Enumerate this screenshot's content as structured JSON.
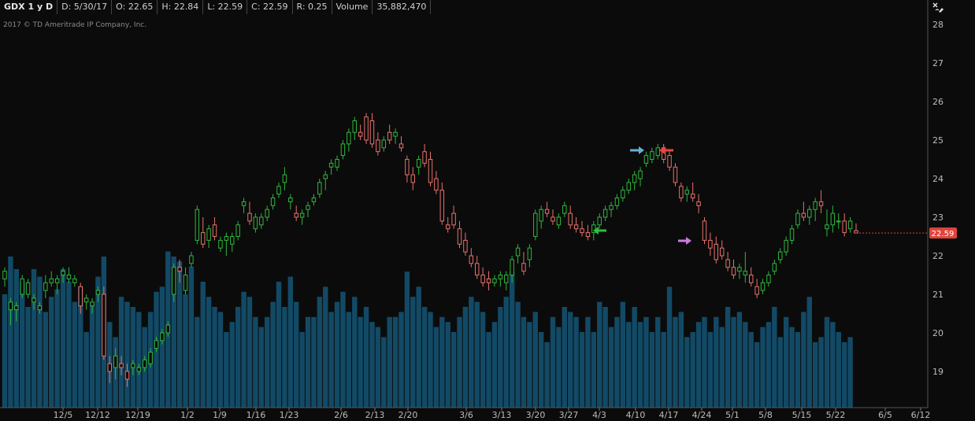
{
  "header": {
    "symbol": "GDX 1 y D",
    "date": "D: 5/30/17",
    "open": "O: 22.65",
    "high": "H: 22.84",
    "low": "L: 22.59",
    "close": "C: 22.59",
    "range": "R: 0.25",
    "volume_label": "Volume",
    "volume_value": "35,882,470"
  },
  "copyright": "2017 © TD Ameritrade IP Company, Inc.",
  "icons": {
    "settings": "settings-style-icon"
  },
  "colors": {
    "up": "#2db83d",
    "down": "#e8716a",
    "volume": "#124a66",
    "last_price_badge": "#e0443a",
    "arrow_blue": "#6aaed6",
    "arrow_red": "#e8483d",
    "arrow_green": "#2dbe3d",
    "arrow_purple": "#c97ce0"
  },
  "chart_data": {
    "type": "candlestick",
    "ylim": [
      18,
      28.3
    ],
    "yticks": [
      "28",
      "27",
      "26",
      "25",
      "24",
      "23",
      "22",
      "21",
      "20",
      "19"
    ],
    "xticks": [
      "12/5",
      "12/12",
      "12/19",
      "1/2",
      "1/9",
      "1/16",
      "1/23",
      "2/6",
      "2/13",
      "2/20",
      "3/6",
      "3/13",
      "3/20",
      "3/27",
      "4/3",
      "4/10",
      "4/17",
      "4/24",
      "5/1",
      "5/8",
      "5/15",
      "5/22",
      "6/5",
      "6/12"
    ],
    "last_price": "22.59",
    "ohlc": [
      [
        21.4,
        21.7,
        21.2,
        21.6
      ],
      [
        20.6,
        20.9,
        20.2,
        20.8
      ],
      [
        20.6,
        20.8,
        20.3,
        20.7
      ],
      [
        21.0,
        21.5,
        20.9,
        21.4
      ],
      [
        21.0,
        21.4,
        20.9,
        21.3
      ],
      [
        20.8,
        21.0,
        20.6,
        20.9
      ],
      [
        20.6,
        20.8,
        20.5,
        20.7
      ],
      [
        21.1,
        21.5,
        20.9,
        21.3
      ],
      [
        21.3,
        21.6,
        21.2,
        21.4
      ],
      [
        21.3,
        21.5,
        21.0,
        21.4
      ],
      [
        21.5,
        21.7,
        21.3,
        21.6
      ],
      [
        21.4,
        21.7,
        21.3,
        21.5
      ],
      [
        21.3,
        21.5,
        21.2,
        21.4
      ],
      [
        21.2,
        21.3,
        20.5,
        20.7
      ],
      [
        20.8,
        21.0,
        20.6,
        20.9
      ],
      [
        20.7,
        20.9,
        20.5,
        20.8
      ],
      [
        21.0,
        21.2,
        20.8,
        21.1
      ],
      [
        21.0,
        21.2,
        19.3,
        19.4
      ],
      [
        19.2,
        19.4,
        18.7,
        19.0
      ],
      [
        19.1,
        19.6,
        18.8,
        19.4
      ],
      [
        19.2,
        19.4,
        18.9,
        19.1
      ],
      [
        19.0,
        19.2,
        18.6,
        18.8
      ],
      [
        19.1,
        19.3,
        18.9,
        19.2
      ],
      [
        19.0,
        19.2,
        18.9,
        19.1
      ],
      [
        19.1,
        19.4,
        19.0,
        19.3
      ],
      [
        19.2,
        19.6,
        19.1,
        19.5
      ],
      [
        19.6,
        19.9,
        19.5,
        19.8
      ],
      [
        19.8,
        20.1,
        19.7,
        20.0
      ],
      [
        20.0,
        20.3,
        19.9,
        20.2
      ],
      [
        21.0,
        21.8,
        20.8,
        21.7
      ],
      [
        21.7,
        21.9,
        21.3,
        21.6
      ],
      [
        21.1,
        21.7,
        21.0,
        21.5
      ],
      [
        21.8,
        22.1,
        21.7,
        22.0
      ],
      [
        22.4,
        23.3,
        22.3,
        23.2
      ],
      [
        22.6,
        23.0,
        22.2,
        22.3
      ],
      [
        22.4,
        22.8,
        22.2,
        22.7
      ],
      [
        22.8,
        23.0,
        22.4,
        22.5
      ],
      [
        22.2,
        22.5,
        22.1,
        22.4
      ],
      [
        22.4,
        22.6,
        22.0,
        22.5
      ],
      [
        22.3,
        22.6,
        22.1,
        22.5
      ],
      [
        22.5,
        22.9,
        22.4,
        22.8
      ],
      [
        23.3,
        23.5,
        23.1,
        23.4
      ],
      [
        23.1,
        23.4,
        22.8,
        22.9
      ],
      [
        22.7,
        23.1,
        22.6,
        23.0
      ],
      [
        22.8,
        23.1,
        22.7,
        23.0
      ],
      [
        23.0,
        23.3,
        22.9,
        23.2
      ],
      [
        23.3,
        23.6,
        23.2,
        23.5
      ],
      [
        23.6,
        23.9,
        23.5,
        23.8
      ],
      [
        23.9,
        24.3,
        23.7,
        24.1
      ],
      [
        23.4,
        23.6,
        23.2,
        23.5
      ],
      [
        23.1,
        23.3,
        22.9,
        23.0
      ],
      [
        23.0,
        23.2,
        22.8,
        23.1
      ],
      [
        23.2,
        23.4,
        23.0,
        23.3
      ],
      [
        23.4,
        23.6,
        23.3,
        23.5
      ],
      [
        23.6,
        24.0,
        23.5,
        23.9
      ],
      [
        24.0,
        24.2,
        23.7,
        24.1
      ],
      [
        24.3,
        24.5,
        24.1,
        24.4
      ],
      [
        24.3,
        24.6,
        24.2,
        24.5
      ],
      [
        24.6,
        25.0,
        24.5,
        24.9
      ],
      [
        24.9,
        25.3,
        24.7,
        25.2
      ],
      [
        25.2,
        25.6,
        25.0,
        25.5
      ],
      [
        25.2,
        25.4,
        25.0,
        25.1
      ],
      [
        25.6,
        25.7,
        24.9,
        25.0
      ],
      [
        25.5,
        25.7,
        24.8,
        24.9
      ],
      [
        25.0,
        25.2,
        24.6,
        24.7
      ],
      [
        24.8,
        25.1,
        24.7,
        25.0
      ],
      [
        25.2,
        25.4,
        24.9,
        25.0
      ],
      [
        25.1,
        25.3,
        24.9,
        25.2
      ],
      [
        24.9,
        25.1,
        24.7,
        24.8
      ],
      [
        24.5,
        24.6,
        23.9,
        24.1
      ],
      [
        24.1,
        24.3,
        23.7,
        23.9
      ],
      [
        24.3,
        24.6,
        24.1,
        24.5
      ],
      [
        24.7,
        24.9,
        24.3,
        24.4
      ],
      [
        24.5,
        24.7,
        23.8,
        23.9
      ],
      [
        24.0,
        24.2,
        23.6,
        23.7
      ],
      [
        23.7,
        23.9,
        22.8,
        22.9
      ],
      [
        22.8,
        23.0,
        22.6,
        22.7
      ],
      [
        23.1,
        23.3,
        22.7,
        22.8
      ],
      [
        22.7,
        22.9,
        22.2,
        22.3
      ],
      [
        22.4,
        22.6,
        22.0,
        22.1
      ],
      [
        22.0,
        22.2,
        21.7,
        21.8
      ],
      [
        21.8,
        22.0,
        21.4,
        21.5
      ],
      [
        21.5,
        21.7,
        21.2,
        21.3
      ],
      [
        21.4,
        21.6,
        21.1,
        21.3
      ],
      [
        21.3,
        21.5,
        21.2,
        21.4
      ],
      [
        21.4,
        21.6,
        21.2,
        21.5
      ],
      [
        21.3,
        21.6,
        21.1,
        21.5
      ],
      [
        21.5,
        22.0,
        21.3,
        21.9
      ],
      [
        22.0,
        22.3,
        21.8,
        22.2
      ],
      [
        21.8,
        22.1,
        21.5,
        21.6
      ],
      [
        21.9,
        22.3,
        21.7,
        22.2
      ],
      [
        22.5,
        23.2,
        22.4,
        23.1
      ],
      [
        22.9,
        23.3,
        22.7,
        23.2
      ],
      [
        23.2,
        23.4,
        23.0,
        23.1
      ],
      [
        23.0,
        23.2,
        22.8,
        22.9
      ],
      [
        22.8,
        23.1,
        22.7,
        23.0
      ],
      [
        23.1,
        23.4,
        23.0,
        23.3
      ],
      [
        23.1,
        23.3,
        22.7,
        22.8
      ],
      [
        22.8,
        23.0,
        22.6,
        22.7
      ],
      [
        22.7,
        22.9,
        22.5,
        22.6
      ],
      [
        22.6,
        22.8,
        22.4,
        22.5
      ],
      [
        22.6,
        22.9,
        22.4,
        22.8
      ],
      [
        22.8,
        23.1,
        22.7,
        23.0
      ],
      [
        23.0,
        23.3,
        22.9,
        23.2
      ],
      [
        23.2,
        23.4,
        23.0,
        23.3
      ],
      [
        23.3,
        23.6,
        23.2,
        23.5
      ],
      [
        23.5,
        23.8,
        23.4,
        23.7
      ],
      [
        23.7,
        24.0,
        23.6,
        23.9
      ],
      [
        23.9,
        24.2,
        23.7,
        24.1
      ],
      [
        24.0,
        24.3,
        23.8,
        24.2
      ],
      [
        24.4,
        24.7,
        24.3,
        24.6
      ],
      [
        24.5,
        24.8,
        24.4,
        24.7
      ],
      [
        24.6,
        24.9,
        24.5,
        24.8
      ],
      [
        24.8,
        24.9,
        24.4,
        24.5
      ],
      [
        24.6,
        24.7,
        24.2,
        24.3
      ],
      [
        24.3,
        24.4,
        23.8,
        23.9
      ],
      [
        23.8,
        23.9,
        23.4,
        23.5
      ],
      [
        23.6,
        23.8,
        23.4,
        23.7
      ],
      [
        23.6,
        23.9,
        23.4,
        23.5
      ],
      [
        23.4,
        23.6,
        23.1,
        23.3
      ],
      [
        22.9,
        23.0,
        22.3,
        22.4
      ],
      [
        22.4,
        22.6,
        22.0,
        22.2
      ],
      [
        22.3,
        22.5,
        21.8,
        21.9
      ],
      [
        22.2,
        22.4,
        21.9,
        22.0
      ],
      [
        21.9,
        22.1,
        21.6,
        21.7
      ],
      [
        21.7,
        21.9,
        21.4,
        21.5
      ],
      [
        21.6,
        21.8,
        21.4,
        21.7
      ],
      [
        21.5,
        22.1,
        21.3,
        21.6
      ],
      [
        21.5,
        21.7,
        21.2,
        21.3
      ],
      [
        21.2,
        21.4,
        20.9,
        21.0
      ],
      [
        21.1,
        21.4,
        21.0,
        21.3
      ],
      [
        21.3,
        21.6,
        21.2,
        21.5
      ],
      [
        21.6,
        21.9,
        21.5,
        21.8
      ],
      [
        21.9,
        22.2,
        21.8,
        22.1
      ],
      [
        22.1,
        22.5,
        22.0,
        22.4
      ],
      [
        22.4,
        22.8,
        22.3,
        22.7
      ],
      [
        22.8,
        23.2,
        22.7,
        23.1
      ],
      [
        23.1,
        23.4,
        22.9,
        23.0
      ],
      [
        23.0,
        23.3,
        22.8,
        23.2
      ],
      [
        23.2,
        23.5,
        22.9,
        23.4
      ],
      [
        23.4,
        23.7,
        23.1,
        23.3
      ],
      [
        22.7,
        23.2,
        22.5,
        22.8
      ],
      [
        22.8,
        23.3,
        22.6,
        23.1
      ],
      [
        22.9,
        23.1,
        22.7,
        22.9
      ],
      [
        22.9,
        23.1,
        22.5,
        22.6
      ],
      [
        22.7,
        23.0,
        22.6,
        22.9
      ],
      [
        22.65,
        22.84,
        22.59,
        22.59
      ]
    ],
    "volume": [
      45,
      60,
      55,
      50,
      40,
      55,
      52,
      38,
      44,
      47,
      55,
      50,
      42,
      48,
      30,
      42,
      52,
      60,
      34,
      28,
      44,
      42,
      40,
      38,
      32,
      38,
      46,
      48,
      62,
      60,
      58,
      45,
      56,
      36,
      50,
      44,
      40,
      38,
      30,
      34,
      40,
      46,
      44,
      36,
      32,
      36,
      42,
      50,
      40,
      52,
      42,
      30,
      36,
      36,
      44,
      48,
      38,
      42,
      46,
      38,
      44,
      36,
      40,
      34,
      32,
      28,
      36,
      36,
      38,
      54,
      44,
      48,
      40,
      38,
      32,
      36,
      34,
      30,
      36,
      40,
      44,
      42,
      38,
      30,
      34,
      40,
      44,
      54,
      42,
      36,
      34,
      38,
      30,
      26,
      36,
      32,
      40,
      38,
      36,
      30,
      36,
      30,
      42,
      40,
      32,
      36,
      42,
      34,
      40,
      34,
      36,
      30,
      36,
      30,
      48,
      36,
      38,
      28,
      30,
      34,
      36,
      30,
      36,
      32,
      40,
      36,
      38,
      34,
      30,
      26,
      32,
      34,
      40,
      28,
      36,
      32,
      30,
      38,
      44,
      26,
      28,
      36,
      34,
      30,
      26,
      28
    ]
  }
}
